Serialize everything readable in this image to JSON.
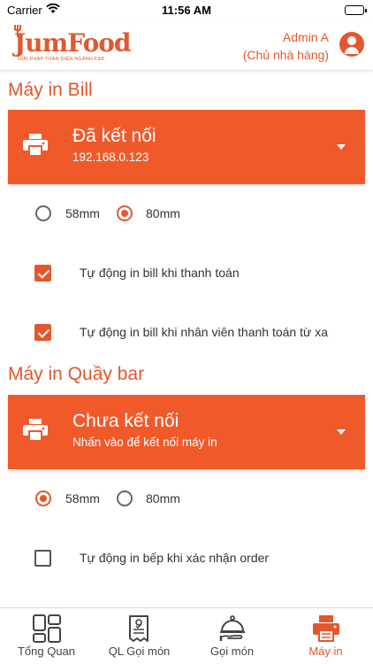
{
  "status_bar": {
    "carrier": "Carrier",
    "time": "11:56 AM"
  },
  "header": {
    "logo_text": "JumFood",
    "logo_tagline": "GIẢI PHÁP TOÀN DIỆN NGÀNH F&B",
    "user_name": "Admin A",
    "user_role": "(Chủ nhà hàng)"
  },
  "sections": [
    {
      "title": "Máy in Bill",
      "printer": {
        "status": "Đã kết nối",
        "detail": "192.168.0.123"
      },
      "paper_options": [
        {
          "label": "58mm",
          "selected": false
        },
        {
          "label": "80mm",
          "selected": true
        }
      ],
      "options": [
        {
          "label": "Tự động in bill khi thanh toán",
          "checked": true
        },
        {
          "label": "Tự động in bill khi nhân viên thanh toán từ xa",
          "checked": true
        }
      ]
    },
    {
      "title": "Máy in Quầy bar",
      "printer": {
        "status": "Chưa kết nối",
        "detail": "Nhấn vào để kết nối máy in"
      },
      "paper_options": [
        {
          "label": "58mm",
          "selected": true
        },
        {
          "label": "80mm",
          "selected": false
        }
      ],
      "options": [
        {
          "label": "Tự động in bếp khi xác nhận order",
          "checked": false
        }
      ]
    }
  ],
  "tabs": [
    {
      "label": "Tổng Quan",
      "icon": "dashboard-icon",
      "active": false
    },
    {
      "label": "QL Gọi món",
      "icon": "menu-list-icon",
      "active": false
    },
    {
      "label": "Gọi món",
      "icon": "cloche-icon",
      "active": false
    },
    {
      "label": "Máy in",
      "icon": "printer-icon",
      "active": true
    }
  ],
  "colors": {
    "accent": "#e4572e",
    "card": "#f05a2a",
    "text": "#333333"
  }
}
